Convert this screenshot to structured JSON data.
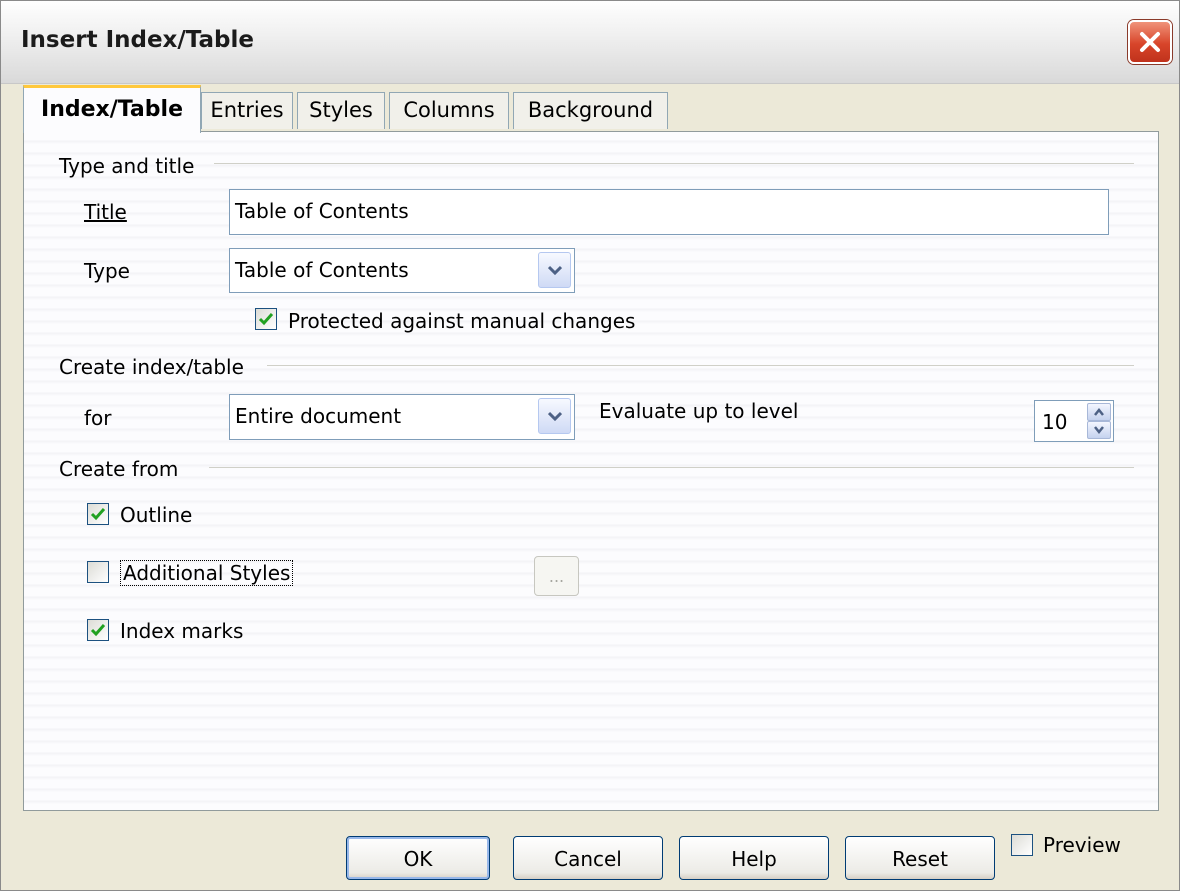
{
  "window": {
    "title": "Insert Index/Table"
  },
  "tabs": [
    {
      "label": "Index/Table",
      "active": true
    },
    {
      "label": "Entries"
    },
    {
      "label": "Styles"
    },
    {
      "label": "Columns"
    },
    {
      "label": "Background"
    }
  ],
  "type_and_title": {
    "heading": "Type and title",
    "title_label": "Title",
    "title_value": "Table of Contents",
    "type_label": "Type",
    "type_value": "Table of Contents",
    "protected_label": "Protected against manual changes",
    "protected_checked": true
  },
  "create_index": {
    "heading": "Create index/table",
    "for_label": "for",
    "for_value": "Entire document",
    "evaluate_label": "Evaluate up to level",
    "level_value": "10"
  },
  "create_from": {
    "heading": "Create from",
    "outline_label": "Outline",
    "outline_checked": true,
    "additional_styles_label": "Additional Styles",
    "additional_styles_checked": false,
    "assign_styles_button": "...",
    "index_marks_label": "Index marks",
    "index_marks_checked": true
  },
  "buttons": {
    "ok": "OK",
    "cancel": "Cancel",
    "help": "Help",
    "reset": "Reset"
  },
  "preview": {
    "label": "Preview",
    "checked": false
  },
  "colors": {
    "checkmark": "#21a121",
    "close_button": "#d8452a",
    "active_tab_accent": "#ffc83c"
  }
}
